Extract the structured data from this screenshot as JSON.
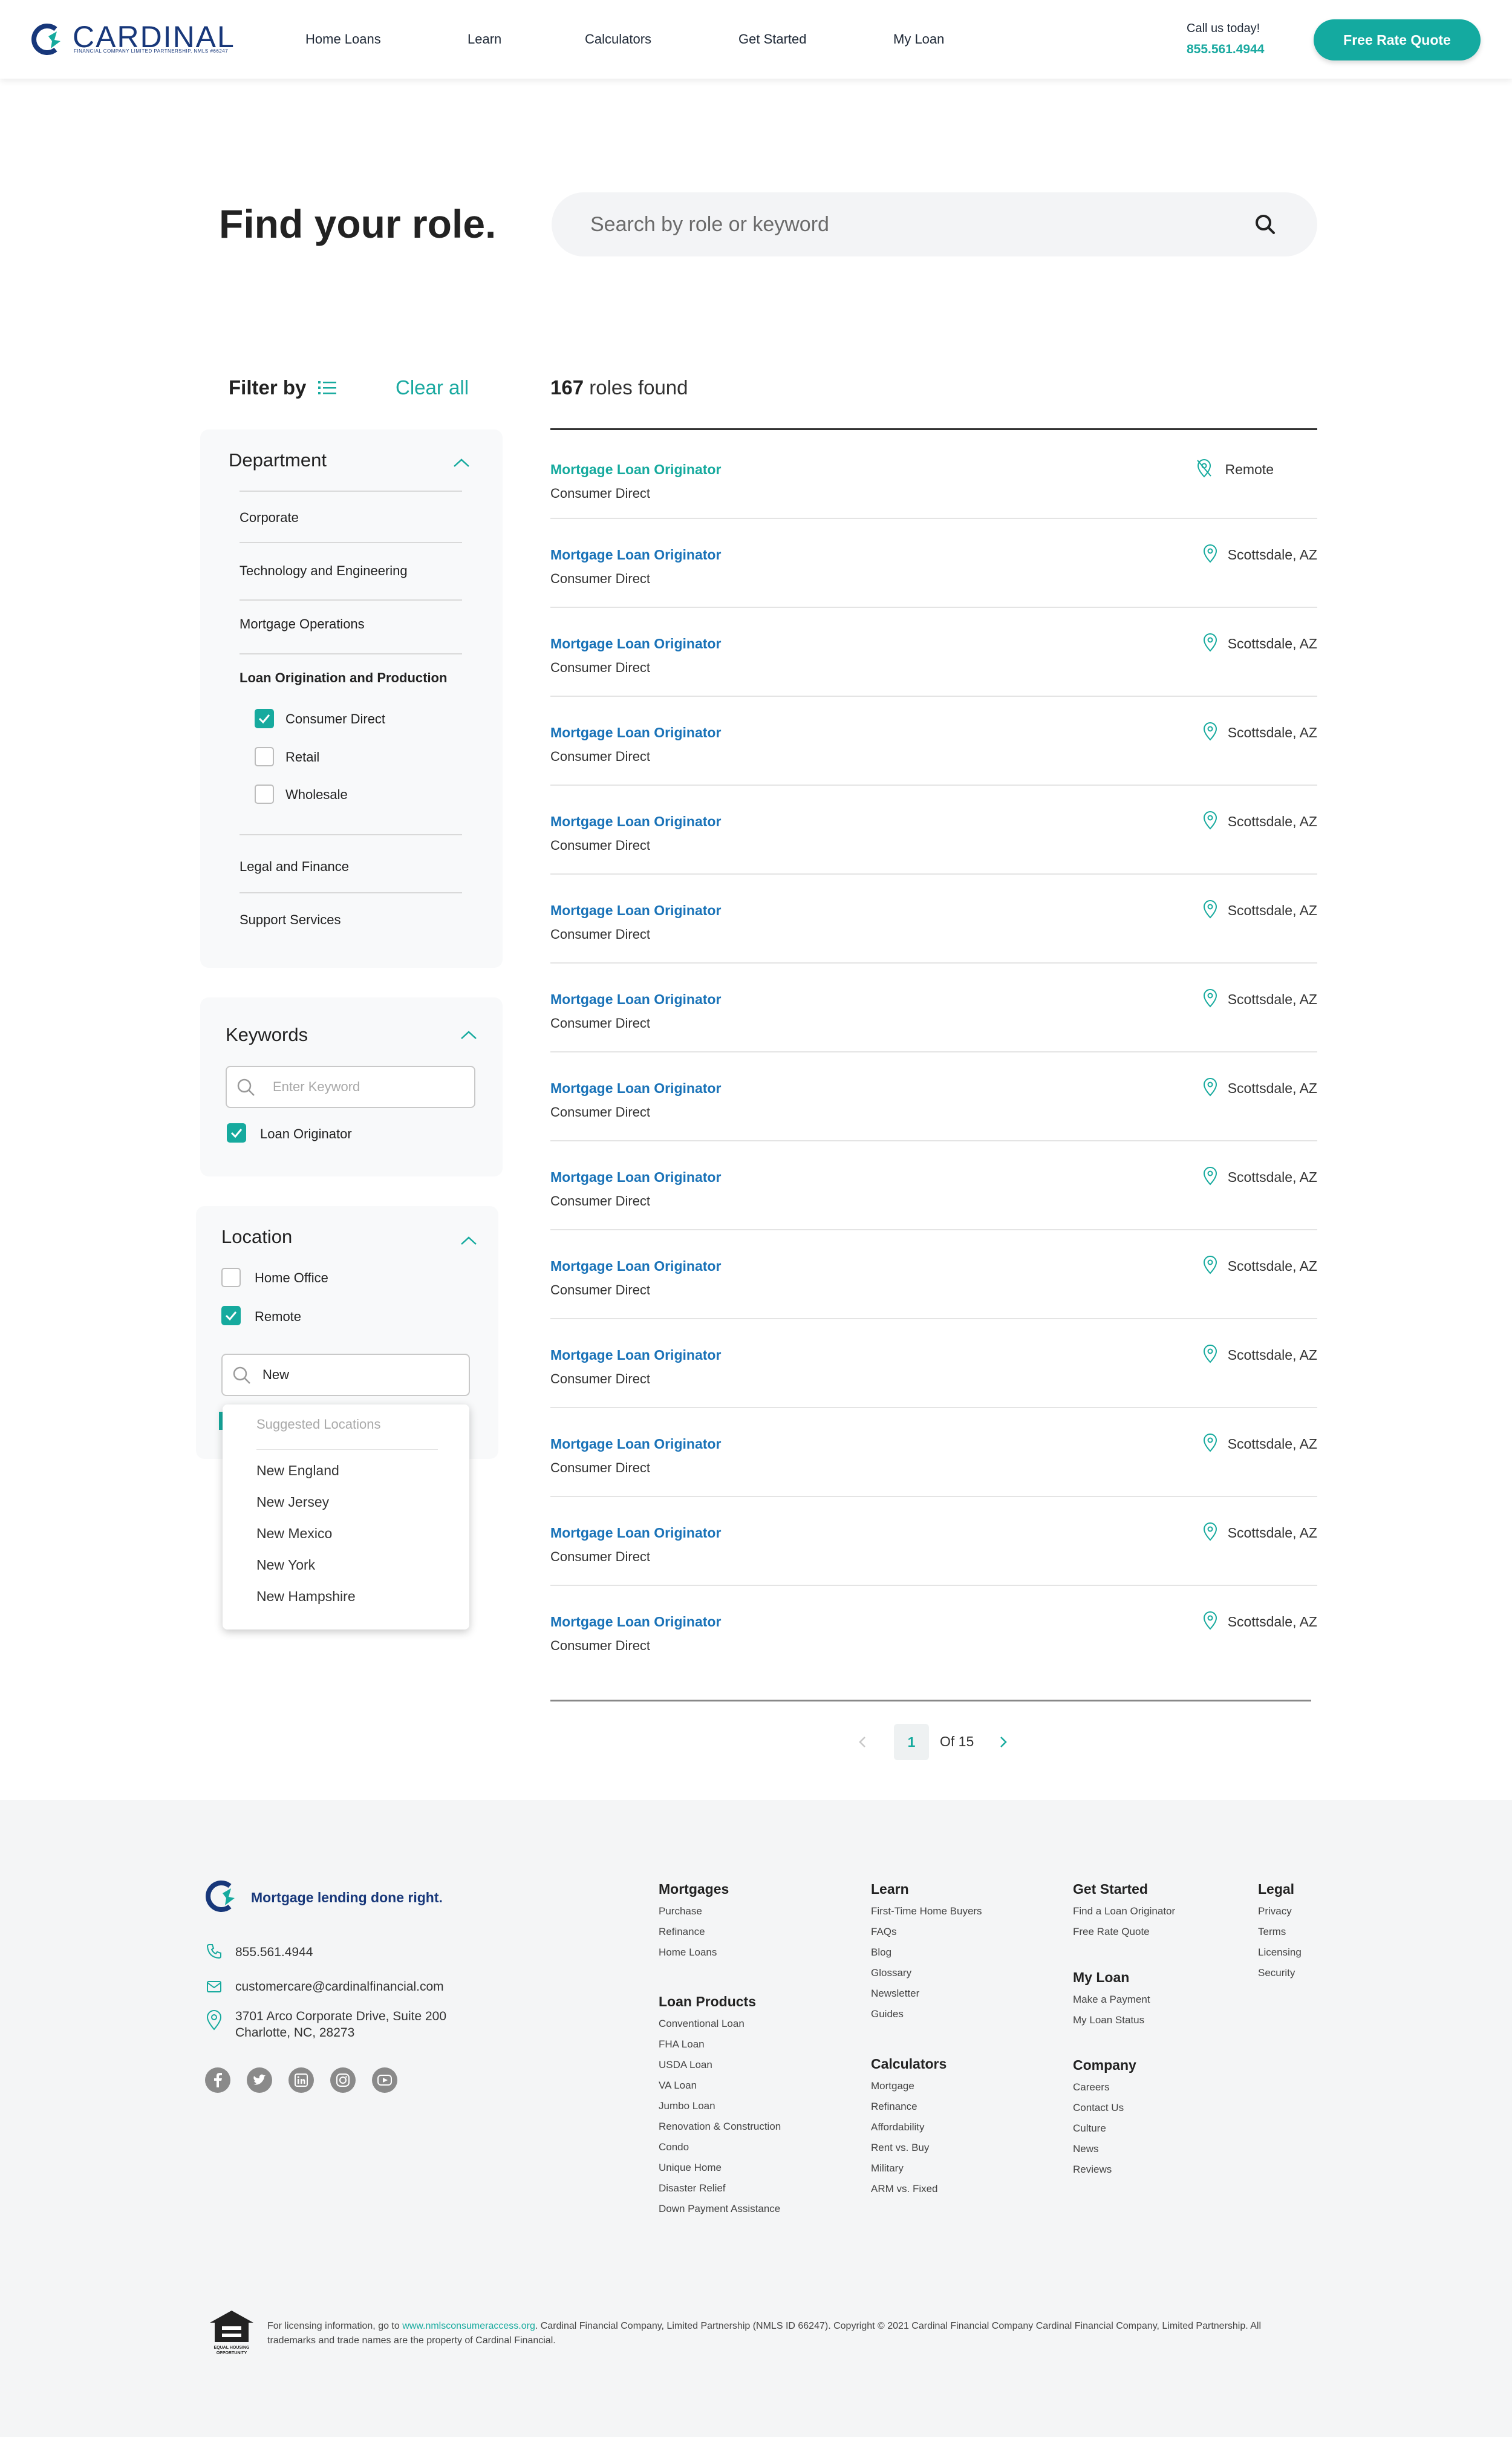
{
  "header": {
    "brand": "CARDINAL",
    "brand_sub": "FINANCIAL COMPANY LIMITED PARTNERSHIP, NMLS #66247",
    "nav": [
      "Home Loans",
      "Learn",
      "Calculators",
      "Get Started",
      "My Loan"
    ],
    "call_label": "Call us today!",
    "call_phone": "855.561.4944",
    "cta_label": "Free Rate Quote"
  },
  "hero": {
    "title_light": "Find your ",
    "title_bold": "role.",
    "search_placeholder": "Search by role or keyword"
  },
  "filters": {
    "filter_by": "Filter by",
    "clear_all": "Clear all",
    "department": {
      "title": "Department",
      "items": [
        "Corporate",
        "Technology and Engineering",
        "Mortgage Operations",
        "Loan Origination and Production",
        "Legal and Finance",
        "Support Services"
      ],
      "sub_options": [
        {
          "label": "Consumer Direct",
          "checked": true
        },
        {
          "label": "Retail",
          "checked": false
        },
        {
          "label": "Wholesale",
          "checked": false
        }
      ]
    },
    "keywords": {
      "title": "Keywords",
      "placeholder": "Enter Keyword",
      "options": [
        {
          "label": "Loan Originator",
          "checked": true
        }
      ]
    },
    "location": {
      "title": "Location",
      "options": [
        {
          "label": "Home Office",
          "checked": false
        },
        {
          "label": "Remote",
          "checked": true
        }
      ],
      "search_value": "New",
      "suggest_head": "Suggested Locations",
      "suggestions": [
        "New England",
        "New Jersey",
        "New Mexico",
        "New York",
        "New Hampshire"
      ]
    }
  },
  "results": {
    "count": "167",
    "count_suffix": " roles found",
    "rows": [
      {
        "title": "Mortgage Loan Originator",
        "dept": "Consumer Direct",
        "location": "Remote",
        "remote": true
      },
      {
        "title": "Mortgage Loan Originator",
        "dept": "Consumer Direct",
        "location": "Scottsdale, AZ",
        "remote": false
      },
      {
        "title": "Mortgage Loan Originator",
        "dept": "Consumer Direct",
        "location": "Scottsdale, AZ",
        "remote": false
      },
      {
        "title": "Mortgage Loan Originator",
        "dept": "Consumer Direct",
        "location": "Scottsdale, AZ",
        "remote": false
      },
      {
        "title": "Mortgage Loan Originator",
        "dept": "Consumer Direct",
        "location": "Scottsdale, AZ",
        "remote": false
      },
      {
        "title": "Mortgage Loan Originator",
        "dept": "Consumer Direct",
        "location": "Scottsdale, AZ",
        "remote": false
      },
      {
        "title": "Mortgage Loan Originator",
        "dept": "Consumer Direct",
        "location": "Scottsdale, AZ",
        "remote": false
      },
      {
        "title": "Mortgage Loan Originator",
        "dept": "Consumer Direct",
        "location": "Scottsdale, AZ",
        "remote": false
      },
      {
        "title": "Mortgage Loan Originator",
        "dept": "Consumer Direct",
        "location": "Scottsdale, AZ",
        "remote": false
      },
      {
        "title": "Mortgage Loan Originator",
        "dept": "Consumer Direct",
        "location": "Scottsdale, AZ",
        "remote": false
      },
      {
        "title": "Mortgage Loan Originator",
        "dept": "Consumer Direct",
        "location": "Scottsdale, AZ",
        "remote": false
      },
      {
        "title": "Mortgage Loan Originator",
        "dept": "Consumer Direct",
        "location": "Scottsdale, AZ",
        "remote": false
      },
      {
        "title": "Mortgage Loan Originator",
        "dept": "Consumer Direct",
        "location": "Scottsdale, AZ",
        "remote": false
      },
      {
        "title": "Mortgage Loan Originator",
        "dept": "Consumer Direct",
        "location": "Scottsdale, AZ",
        "remote": false
      }
    ]
  },
  "pagination": {
    "current": "1",
    "of": "Of 15"
  },
  "footer": {
    "tagline": "Mortgage lending done right.",
    "phone": "855.561.4944",
    "email": "customercare@cardinalfinancial.com",
    "address_1": "3701 Arco Corporate Drive, Suite 200",
    "address_2": "Charlotte, NC, 28273",
    "social": [
      "facebook-icon",
      "twitter-icon",
      "linkedin-icon",
      "instagram-icon",
      "youtube-icon"
    ],
    "columns": [
      {
        "head": "Mortgages",
        "links": [
          "Purchase",
          "Refinance",
          "Home Loans"
        ]
      },
      {
        "head": "Loan Products",
        "links": [
          "Conventional Loan",
          "FHA Loan",
          "USDA Loan",
          "VA Loan",
          "Jumbo Loan",
          "Renovation & Construction",
          "Condo",
          "Unique Home",
          "Disaster Relief",
          "Down Payment Assistance"
        ]
      },
      {
        "head": "Learn",
        "links": [
          "First-Time Home Buyers",
          "FAQs",
          "Blog",
          "Glossary",
          "Newsletter",
          "Guides"
        ]
      },
      {
        "head": "Calculators",
        "links": [
          "Mortgage",
          "Refinance",
          "Affordability",
          "Rent vs. Buy",
          "Military",
          "ARM vs. Fixed"
        ]
      },
      {
        "head": "Get Started",
        "links": [
          "Find a Loan Originator",
          "Free Rate Quote"
        ]
      },
      {
        "head": "My Loan",
        "links": [
          "Make a Payment",
          "My Loan Status"
        ]
      },
      {
        "head": "Company",
        "links": [
          "Careers",
          "Contact Us",
          "Culture",
          "News",
          "Reviews"
        ]
      },
      {
        "head": "Legal",
        "links": [
          "Privacy",
          "Terms",
          "Licensing",
          "Security"
        ]
      }
    ],
    "legal_prefix": "For licensing information, go to ",
    "legal_link": "www.nmlsconsumeraccess.org",
    "legal_suffix": ". Cardinal Financial Company, Limited Partnership (NMLS ID 66247). Copyright © 2021 Cardinal Financial Company Cardinal Financial Company, Limited Partnership. All trademarks and trade names are the property of Cardinal Financial.",
    "eho_text": "EQUAL HOUSING OPPORTUNITY"
  },
  "colors": {
    "teal": "#16aa9e",
    "navy": "#17377a",
    "link_blue": "#1a73b8"
  }
}
